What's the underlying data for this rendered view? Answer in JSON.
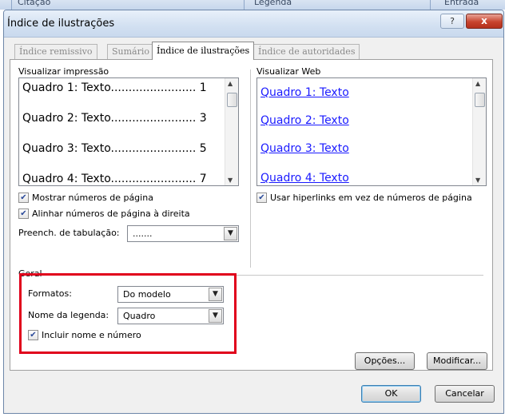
{
  "background_strip": {
    "items": [
      "Citação",
      "Legenda",
      "Entrada"
    ]
  },
  "dialog": {
    "title": "Índice de ilustrações",
    "help_symbol": "?",
    "close_symbol": "x"
  },
  "tabs": [
    {
      "label": "Índice remissivo",
      "active": false
    },
    {
      "label": "Sumário",
      "active": false
    },
    {
      "label": "Índice de ilustrações",
      "active": true
    },
    {
      "label": "Índice de autoridades",
      "active": false
    }
  ],
  "print_preview": {
    "label": "Visualizar impressão",
    "entries": [
      "Quadro 1: Texto........................ 1",
      "Quadro 2: Texto........................ 3",
      "Quadro 3: Texto........................ 5",
      "Quadro 4: Texto........................ 7"
    ]
  },
  "web_preview": {
    "label": "Visualizar Web",
    "entries": [
      "Quadro 1: Texto",
      "Quadro 2: Texto",
      "Quadro 3: Texto",
      "Quadro 4: Texto"
    ]
  },
  "options": {
    "show_page_numbers": {
      "label": "Mostrar números de página",
      "checked": true
    },
    "right_align": {
      "label": "Alinhar números de página à direita",
      "checked": true
    },
    "tab_leader": {
      "label": "Preench. de tabulação:",
      "value": "......."
    },
    "use_hyperlinks": {
      "label": "Usar hiperlinks em vez de números de página",
      "checked": true
    }
  },
  "general": {
    "label": "Geral",
    "formats": {
      "label": "Formatos:",
      "value": "Do modelo"
    },
    "caption_label": {
      "label": "Nome da legenda:",
      "value": "Quadro"
    },
    "include_label": {
      "label": "Incluir nome e número",
      "checked": true
    }
  },
  "buttons": {
    "options": "Opções...",
    "modify": "Modificar...",
    "ok": "OK",
    "cancel": "Cancelar"
  },
  "highlight_color": "#e0001b"
}
